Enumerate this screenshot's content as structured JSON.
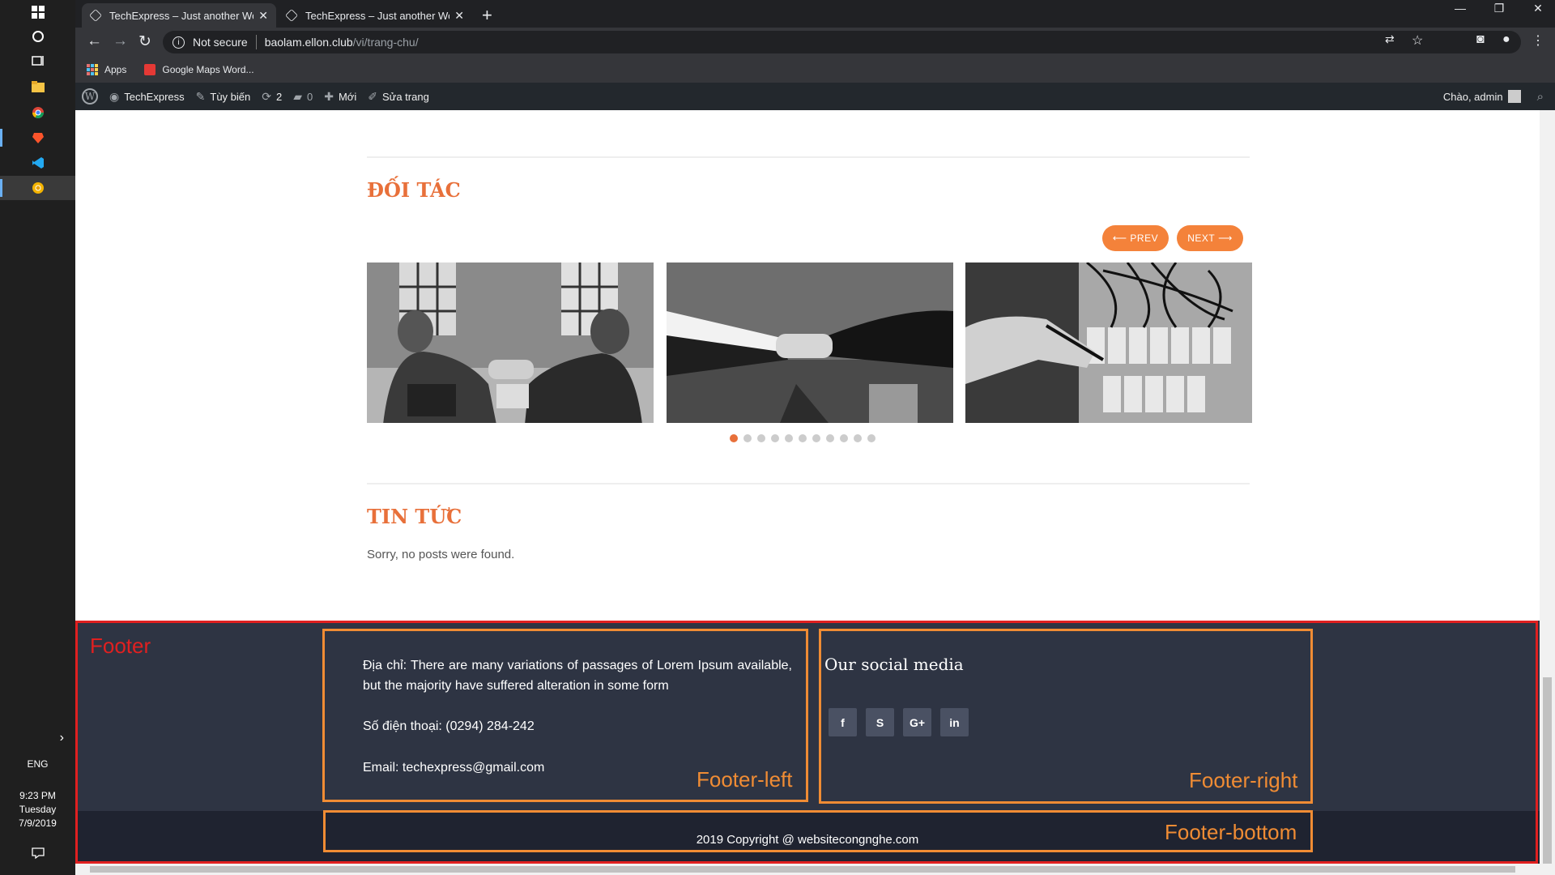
{
  "taskbar": {
    "lang": "ENG",
    "time": "9:23 PM",
    "day": "Tuesday",
    "date": "7/9/2019",
    "icons": [
      "windows-icon",
      "search-icon",
      "task-view-icon",
      "file-explorer-icon",
      "chrome-icon",
      "brave-icon",
      "vscode-icon",
      "chrome-canary-icon"
    ]
  },
  "browser": {
    "tabs": [
      {
        "title": "TechExpress – Just another WordPress site",
        "active": true
      },
      {
        "title": "TechExpress – Just another WordPress site",
        "active": false
      }
    ],
    "security": "Not secure",
    "url_host": "baolam.ellon.club",
    "url_path": "/vi/trang-chu/",
    "bookmarks": [
      "Apps",
      "Google Maps Word..."
    ]
  },
  "adminbar": {
    "site": "TechExpress",
    "customize": "Tùy biến",
    "updates": "2",
    "comments": "0",
    "new": "Mới",
    "edit": "Sửa trang",
    "greeting": "Chào, admin"
  },
  "partners": {
    "title": "ĐỐI TÁC",
    "prev": "PREV",
    "next": "NEXT",
    "images": [
      "handshake-office-photo",
      "handshake-suits-photo",
      "electrical-panel-photo"
    ],
    "dot_count": 11,
    "active_dot": 0
  },
  "news": {
    "title": "TIN TỨC",
    "empty_message": "Sorry, no posts were found."
  },
  "footer": {
    "address": "Địa chỉ: There are many variations of passages of Lorem Ipsum available, but the majority have suffered alteration in some form",
    "phone": "Số điện thoại: (0294) 284-242",
    "email": "Email: techexpress@gmail.com",
    "social_title": "Our social media",
    "social": [
      "f",
      "S",
      "G+",
      "in"
    ],
    "copyright": "2019 Copyright @ websitecongnghe.com"
  },
  "annotations": {
    "footer": "Footer",
    "footer_left": "Footer-left",
    "footer_right": "Footer-right",
    "footer_bottom": "Footer-bottom"
  },
  "colors": {
    "accent": "#e8703a",
    "footer_bg": "#2e3443",
    "annotation_red": "#e02020",
    "annotation_orange": "#f08c34"
  }
}
